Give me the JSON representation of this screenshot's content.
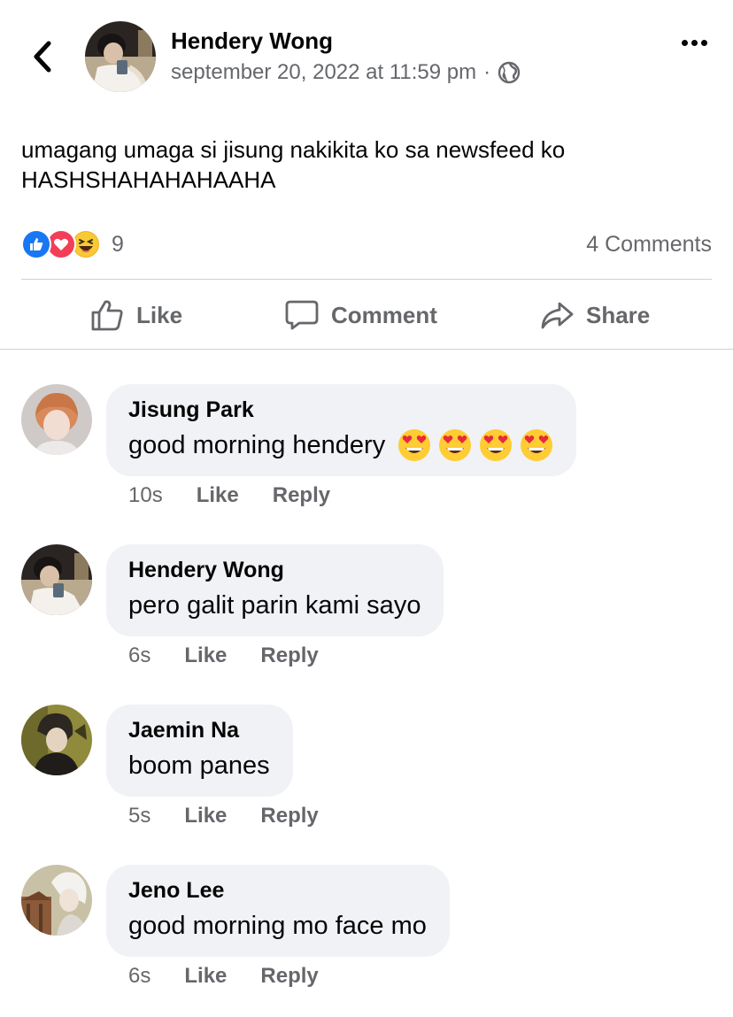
{
  "post": {
    "author": "Hendery Wong",
    "timestamp": "september 20, 2022 at 11:59 pm",
    "separator": "·",
    "privacy_icon": "globe-icon",
    "text_line1": "umagang umaga si jisung nakikita ko sa newsfeed ko",
    "text_line2": "HASHSHAHAHAHAAHA",
    "reaction_count": "9",
    "reaction_icons": [
      "like-reaction-icon",
      "love-reaction-icon",
      "haha-reaction-icon"
    ],
    "comments_count": "4 Comments"
  },
  "actions": {
    "like": "Like",
    "comment": "Comment",
    "share": "Share"
  },
  "comments": [
    {
      "name": "Jisung Park",
      "text": "good morning hendery",
      "emoji_count": 4,
      "time": "10s",
      "like": "Like",
      "reply": "Reply"
    },
    {
      "name": "Hendery Wong",
      "text": "pero galit parin kami sayo",
      "time": "6s",
      "like": "Like",
      "reply": "Reply"
    },
    {
      "name": "Jaemin Na",
      "text": "boom panes",
      "time": "5s",
      "like": "Like",
      "reply": "Reply"
    },
    {
      "name": "Jeno Lee",
      "text": "good morning mo face mo",
      "time": "6s",
      "like": "Like",
      "reply": "Reply"
    }
  ],
  "colors": {
    "like_blue": "#1877f2",
    "love_red": "#f33e58",
    "haha_yellow": "#f7b125",
    "bubble_bg": "#f0f2f5",
    "secondary_text": "#65676b"
  }
}
